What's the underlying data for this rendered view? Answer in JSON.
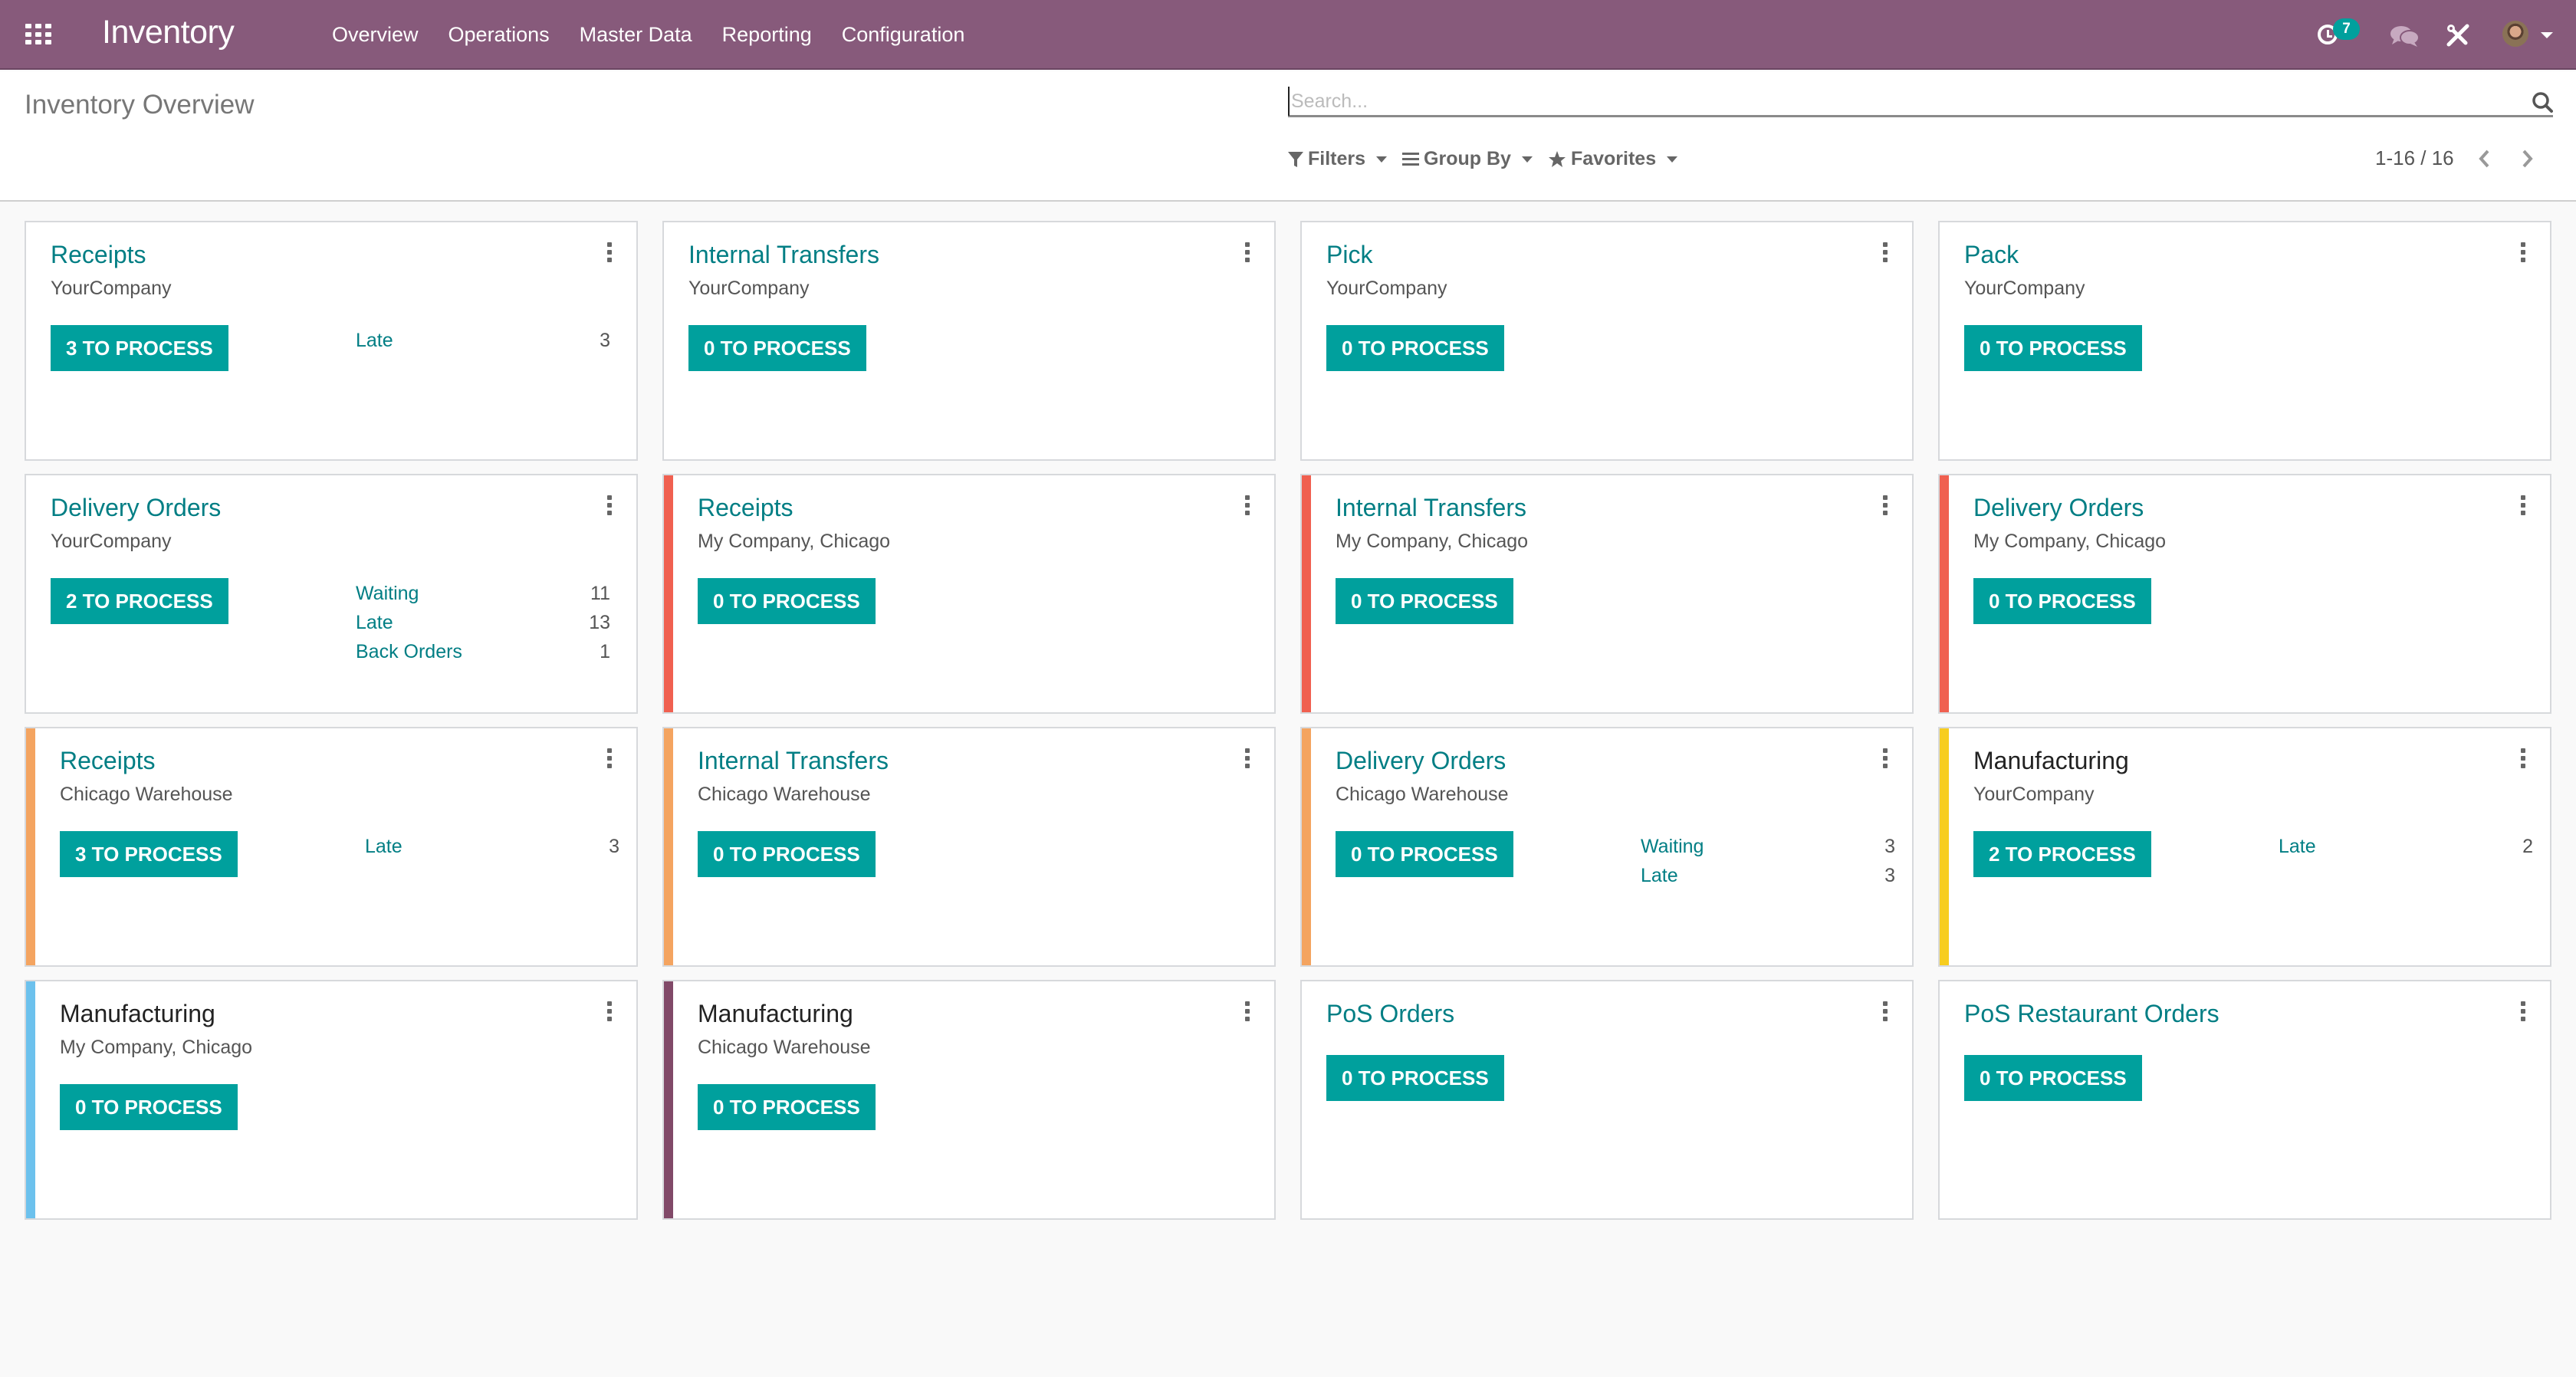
{
  "navbar": {
    "app_title": "Inventory",
    "menu": [
      "Overview",
      "Operations",
      "Master Data",
      "Reporting",
      "Configuration"
    ],
    "activity_count": "7",
    "icons": [
      "apps-grid-icon",
      "clock-icon",
      "chat-icon",
      "tools-icon",
      "avatar"
    ]
  },
  "control_panel": {
    "breadcrumb": "Inventory Overview",
    "search_placeholder": "Search...",
    "search_value": "",
    "filters_label": "Filters",
    "groupby_label": "Group By",
    "favorites_label": "Favorites",
    "pager": "1-16 / 16"
  },
  "colors": {
    "navbar": "#875a7b",
    "primary": "#00a09d",
    "link": "#017e84",
    "red": "#f06050",
    "orange": "#f4a460",
    "yellow": "#f7cd1f",
    "blue": "#6cc1ed",
    "purple": "#814968"
  },
  "cards": [
    {
      "title": "Receipts",
      "subtitle": "YourCompany",
      "button": "3 TO PROCESS",
      "color": "",
      "title_dark": false,
      "stats": [
        {
          "label": "Late",
          "value": "3"
        }
      ]
    },
    {
      "title": "Internal Transfers",
      "subtitle": "YourCompany",
      "button": "0 TO PROCESS",
      "color": "",
      "title_dark": false,
      "stats": []
    },
    {
      "title": "Pick",
      "subtitle": "YourCompany",
      "button": "0 TO PROCESS",
      "color": "",
      "title_dark": false,
      "stats": []
    },
    {
      "title": "Pack",
      "subtitle": "YourCompany",
      "button": "0 TO PROCESS",
      "color": "",
      "title_dark": false,
      "stats": []
    },
    {
      "title": "Delivery Orders",
      "subtitle": "YourCompany",
      "button": "2 TO PROCESS",
      "color": "",
      "title_dark": false,
      "stats": [
        {
          "label": "Waiting",
          "value": "11"
        },
        {
          "label": "Late",
          "value": "13"
        },
        {
          "label": "Back Orders",
          "value": "1"
        }
      ]
    },
    {
      "title": "Receipts",
      "subtitle": "My Company, Chicago",
      "button": "0 TO PROCESS",
      "color": "#f06050",
      "title_dark": false,
      "stats": []
    },
    {
      "title": "Internal Transfers",
      "subtitle": "My Company, Chicago",
      "button": "0 TO PROCESS",
      "color": "#f06050",
      "title_dark": false,
      "stats": []
    },
    {
      "title": "Delivery Orders",
      "subtitle": "My Company, Chicago",
      "button": "0 TO PROCESS",
      "color": "#f06050",
      "title_dark": false,
      "stats": []
    },
    {
      "title": "Receipts",
      "subtitle": "Chicago Warehouse",
      "button": "3 TO PROCESS",
      "color": "#f4a460",
      "title_dark": false,
      "stats": [
        {
          "label": "Late",
          "value": "3"
        }
      ]
    },
    {
      "title": "Internal Transfers",
      "subtitle": "Chicago Warehouse",
      "button": "0 TO PROCESS",
      "color": "#f4a460",
      "title_dark": false,
      "stats": []
    },
    {
      "title": "Delivery Orders",
      "subtitle": "Chicago Warehouse",
      "button": "0 TO PROCESS",
      "color": "#f4a460",
      "title_dark": false,
      "stats": [
        {
          "label": "Waiting",
          "value": "3"
        },
        {
          "label": "Late",
          "value": "3"
        }
      ]
    },
    {
      "title": "Manufacturing",
      "subtitle": "YourCompany",
      "button": "2 TO PROCESS",
      "color": "#f7cd1f",
      "title_dark": true,
      "stats": [
        {
          "label": "Late",
          "value": "2"
        }
      ]
    },
    {
      "title": "Manufacturing",
      "subtitle": "My Company, Chicago",
      "button": "0 TO PROCESS",
      "color": "#6cc1ed",
      "title_dark": true,
      "stats": []
    },
    {
      "title": "Manufacturing",
      "subtitle": "Chicago Warehouse",
      "button": "0 TO PROCESS",
      "color": "#814968",
      "title_dark": true,
      "stats": []
    },
    {
      "title": "PoS Orders",
      "subtitle": "",
      "button": "0 TO PROCESS",
      "color": "",
      "title_dark": false,
      "stats": []
    },
    {
      "title": "PoS Restaurant Orders",
      "subtitle": "",
      "button": "0 TO PROCESS",
      "color": "",
      "title_dark": false,
      "stats": []
    }
  ]
}
